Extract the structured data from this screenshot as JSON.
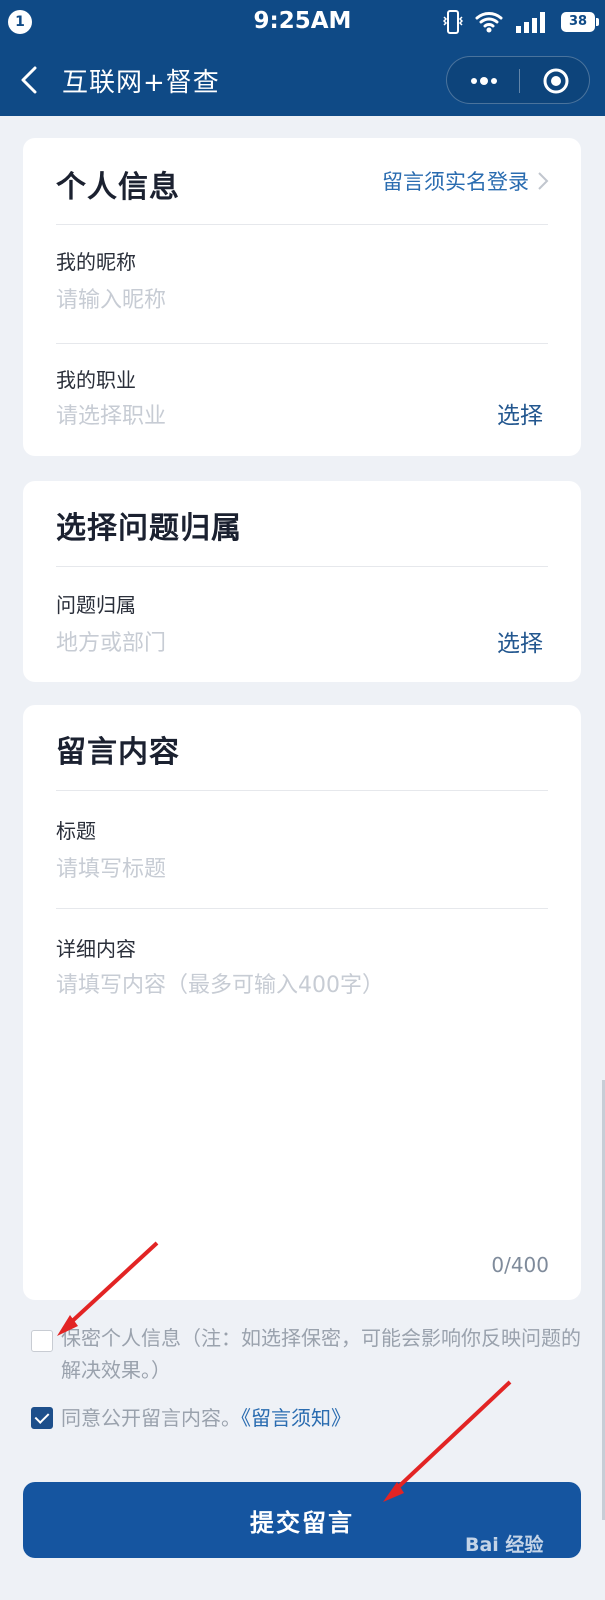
{
  "status_bar": {
    "notification_count": "1",
    "time": "9:25AM",
    "battery": "38"
  },
  "header": {
    "title": "互联网+督查"
  },
  "personal_info": {
    "title": "个人信息",
    "login_link": "留言须实名登录",
    "nickname_label": "我的昵称",
    "nickname_placeholder": "请输入昵称",
    "job_label": "我的职业",
    "job_placeholder": "请选择职业",
    "select_label": "选择"
  },
  "issue": {
    "title": "选择问题归属",
    "label": "问题归属",
    "placeholder": "地方或部门",
    "select_label": "选择"
  },
  "message": {
    "title": "留言内容",
    "subject_label": "标题",
    "subject_placeholder": "请填写标题",
    "detail_label": "详细内容",
    "detail_placeholder": "请填写内容（最多可输入400字）",
    "counter": "0/400"
  },
  "options": {
    "privacy_text": "保密个人信息（注：如选择保密，可能会影响你反映问题的解决效果。）",
    "privacy_checked": false,
    "public_text": "同意公开留言内容。",
    "notice_link": "《留言须知》",
    "public_checked": true
  },
  "submit_label": "提交留言",
  "watermark": "Bai 经验",
  "colors": {
    "header": "#0f4a86",
    "button": "#1555a0",
    "link": "#2a6cb0",
    "annotation_arrows": "#e22424"
  }
}
